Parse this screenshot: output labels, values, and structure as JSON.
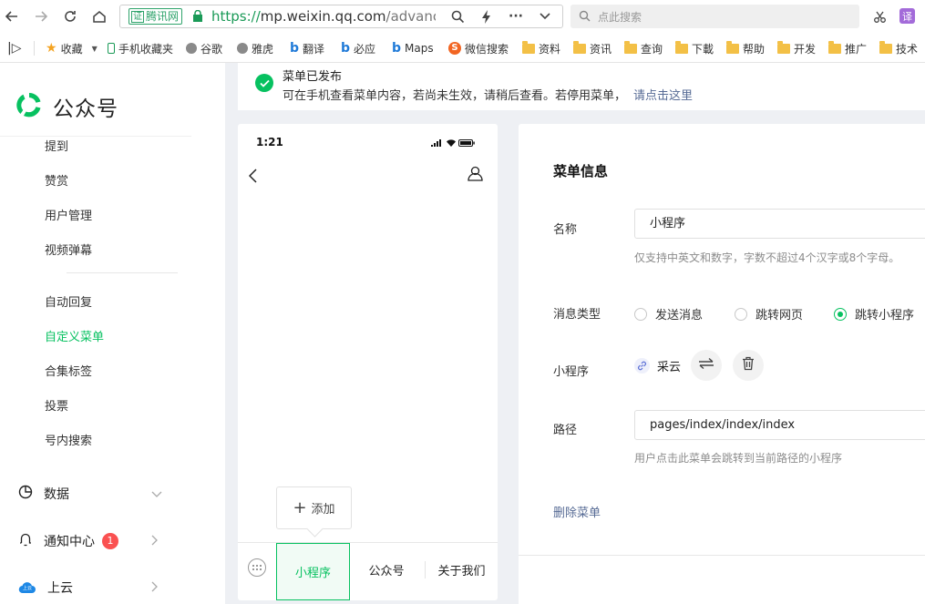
{
  "browser": {
    "cert_badge_char": "证",
    "cert_label": "腾讯网",
    "url_scheme": "https://",
    "url_host": "mp.weixin.qq.com",
    "url_path": "/advanced/s",
    "search_placeholder": "点此搜索",
    "translate_label": "译"
  },
  "bookmarks": [
    {
      "label": "收藏",
      "icon": "star-icon"
    },
    {
      "label": "手机收藏夹",
      "icon": "phone-icon"
    },
    {
      "label": "谷歌",
      "icon": "globe-icon"
    },
    {
      "label": "雅虎",
      "icon": "globe-icon"
    },
    {
      "label": "翻译",
      "icon": "bing-icon"
    },
    {
      "label": "必应",
      "icon": "bing-icon"
    },
    {
      "label": "Maps",
      "icon": "bing-icon"
    },
    {
      "label": "微信搜索",
      "icon": "sogou-icon"
    },
    {
      "label": "资料",
      "icon": "folder-icon"
    },
    {
      "label": "资讯",
      "icon": "folder-icon"
    },
    {
      "label": "查询",
      "icon": "folder-icon"
    },
    {
      "label": "下載",
      "icon": "folder-icon"
    },
    {
      "label": "帮助",
      "icon": "folder-icon"
    },
    {
      "label": "开发",
      "icon": "folder-icon"
    },
    {
      "label": "推广",
      "icon": "folder-icon"
    },
    {
      "label": "技术",
      "icon": "folder-icon"
    }
  ],
  "sidebar": {
    "logo_text": "公众号",
    "items_top": [
      "提到",
      "赞赏",
      "用户管理",
      "视频弹幕"
    ],
    "items_mid": [
      "自动回复",
      "自定义菜单",
      "合集标签",
      "投票",
      "号内搜索"
    ],
    "active_item": "自定义菜单",
    "data_label": "数据",
    "notify_label": "通知中心",
    "notify_count": "1",
    "cloud_label": "上云",
    "cloud_icon_text": "上云"
  },
  "notice": {
    "title": "菜单已发布",
    "text": "可在手机查看菜单内容，若尚未生效，请稍后查看。若停用菜单，",
    "link": "请点击这里"
  },
  "phone": {
    "time": "1:21",
    "add_label": "添加",
    "menus": [
      "小程序",
      "公众号",
      "关于我们"
    ]
  },
  "panel": {
    "title": "菜单信息",
    "name_label": "名称",
    "name_value": "小程序",
    "name_hint": "仅支持中英文和数字，字数不超过4个汉字或8个字母。",
    "type_label": "消息类型",
    "type_options": [
      "发送消息",
      "跳转网页",
      "跳转小程序"
    ],
    "type_selected": "跳转小程序",
    "mp_label": "小程序",
    "mp_value": "采云",
    "path_label": "路径",
    "path_value": "pages/index/index/index",
    "path_hint": "用户点击此菜单会跳转到当前路径的小程序",
    "delete_label": "删除菜单"
  },
  "colors": {
    "accent": "#07c160",
    "link": "#576b95",
    "badge": "#fa5151"
  }
}
